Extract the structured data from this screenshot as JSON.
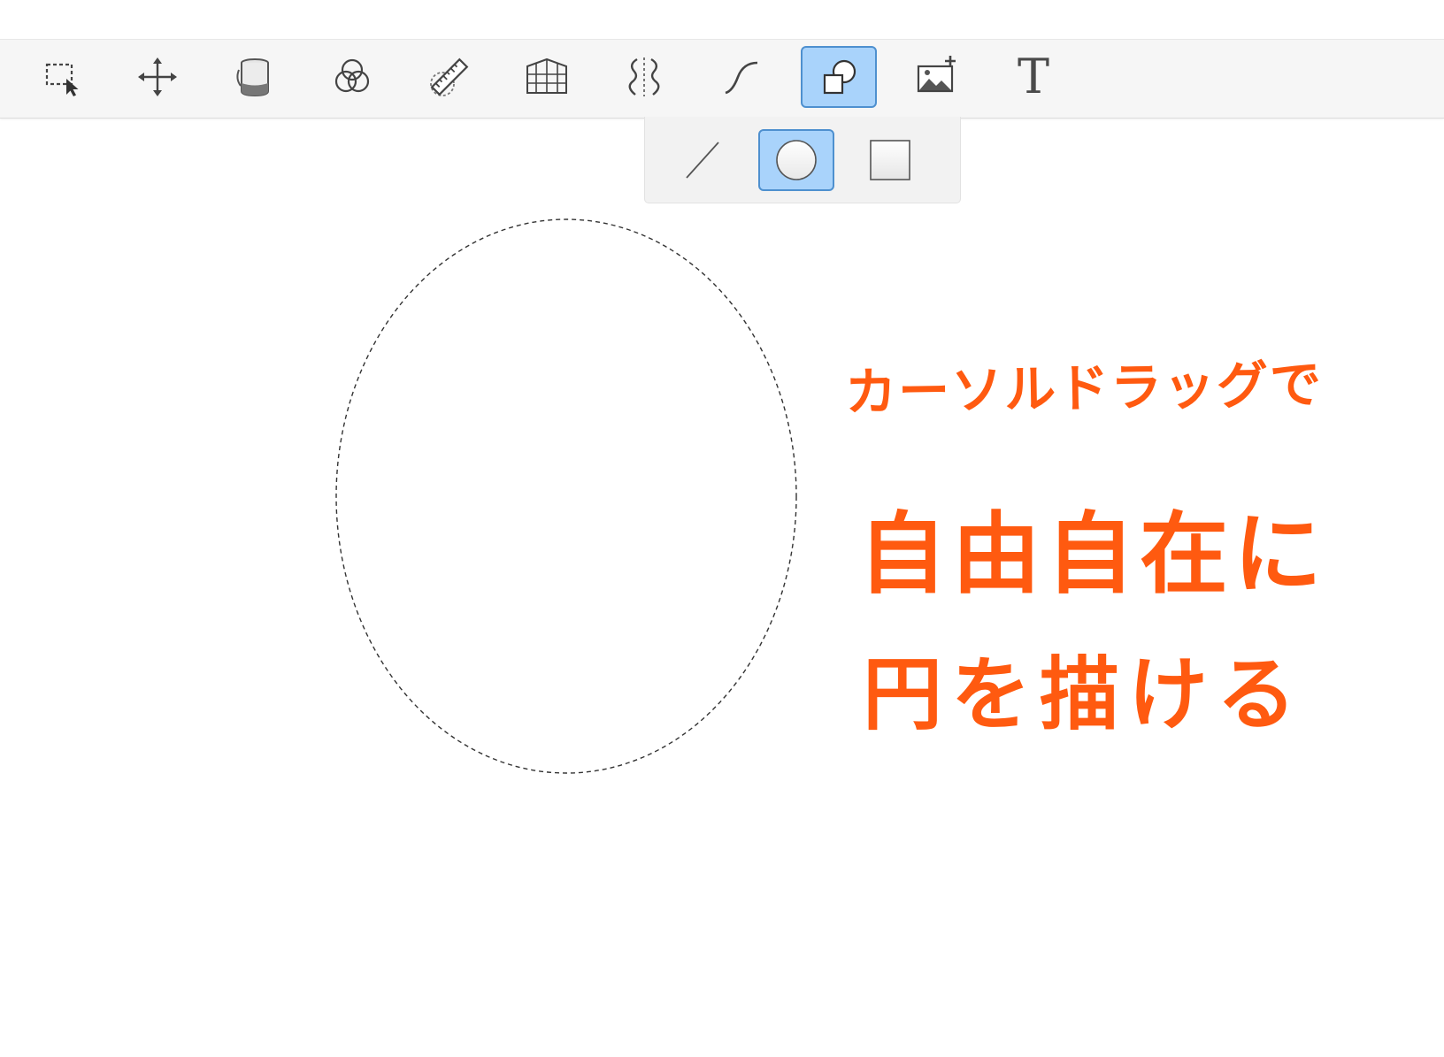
{
  "toolbar": {
    "tools": [
      {
        "name": "selection-tool",
        "icon": "marquee-select-icon"
      },
      {
        "name": "move-tool",
        "icon": "move-arrows-icon"
      },
      {
        "name": "fill-tool",
        "icon": "paint-bucket-icon"
      },
      {
        "name": "blend-tool",
        "icon": "overlapping-circles-icon"
      },
      {
        "name": "ruler-tool",
        "icon": "ruler-icon"
      },
      {
        "name": "perspective-tool",
        "icon": "perspective-grid-icon"
      },
      {
        "name": "symmetry-tool",
        "icon": "symmetry-icon"
      },
      {
        "name": "curve-tool",
        "icon": "curve-icon"
      },
      {
        "name": "shape-tool",
        "icon": "shapes-icon",
        "active": true
      },
      {
        "name": "insert-image-tool",
        "icon": "image-add-icon"
      },
      {
        "name": "text-tool",
        "icon": "text-icon",
        "glyph": "T"
      }
    ]
  },
  "shape_subbar": {
    "options": [
      {
        "name": "line-shape",
        "icon": "line-icon"
      },
      {
        "name": "ellipse-shape",
        "icon": "circle-icon",
        "active": true
      },
      {
        "name": "rectangle-shape",
        "icon": "square-icon"
      }
    ]
  },
  "annotation": {
    "line1": "カーソルドラッグで",
    "line2": "自由自在に",
    "line3": "円を描ける",
    "color": "#ff5a10"
  },
  "colors": {
    "active_bg": "#a9d3fb",
    "active_border": "#4e90cf",
    "toolbar_bg": "#f6f6f6"
  }
}
